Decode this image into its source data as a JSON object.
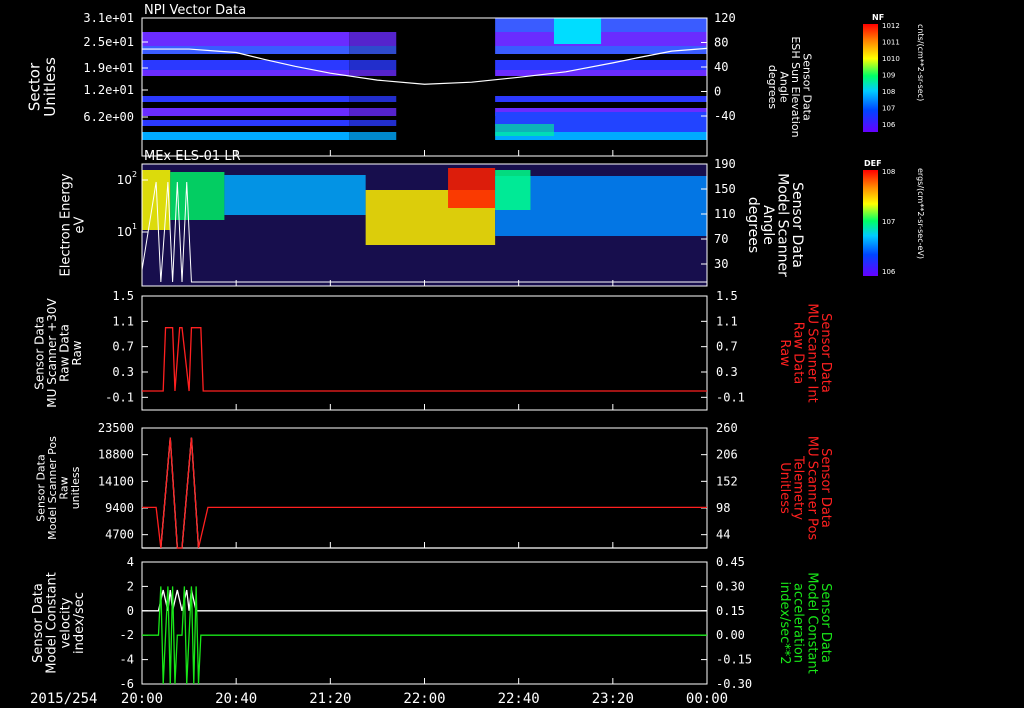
{
  "footer": {
    "date": "2015/254",
    "time_ticks": [
      "20:00",
      "20:40",
      "21:20",
      "22:00",
      "22:40",
      "23:20",
      "00:00"
    ]
  },
  "colors": {
    "background": "#000000",
    "white": "#ffffff",
    "red": "#ff2020",
    "green": "#19e619"
  },
  "chart_data": [
    {
      "type": "heatmap",
      "title": "NPI Vector Data",
      "ylabel": "Sector\nUnitless",
      "y_ticks": [
        "3.1e+01",
        "2.5e+01",
        "1.9e+01",
        "1.2e+01",
        "6.2e+00"
      ],
      "right_axis": {
        "label": "Sensor Data\nESH Sun Elevation\nAngle\ndegrees",
        "ticks": [
          "120",
          "80",
          "40",
          "0",
          "-40"
        ],
        "range": [
          -80,
          120
        ]
      },
      "colorbar": {
        "label": "NF",
        "units": "cnts/(cm**2-sr-sec)",
        "ticks": [
          "10^12",
          "10^11",
          "10^10",
          "10^9",
          "10^8",
          "10^7",
          "10^6"
        ]
      },
      "overlay_line": {
        "x": [
          0,
          20,
          32,
          40,
          52,
          65,
          80,
          100,
          120,
          140,
          160,
          180,
          200,
          210,
          225,
          240
        ],
        "y": [
          75,
          75,
          72,
          70,
          60,
          50,
          40,
          30,
          24,
          27,
          34,
          42,
          55,
          62,
          72,
          76
        ]
      }
    },
    {
      "type": "heatmap",
      "title": "MEx ELS-01 LR",
      "ylabel": "Electron Energy\neV",
      "y_ticks": [
        "10^2",
        "10^1"
      ],
      "right_axis": {
        "label": "Sensor Data\nModel Scanner\nAngle\ndegrees",
        "ticks": [
          "190",
          "150",
          "110",
          "70",
          "30"
        ]
      },
      "colorbar": {
        "label": "DEF",
        "units": "ergs/(cm**2-sr-sec-eV)",
        "ticks": [
          "10^8",
          "10^7",
          "10^6"
        ]
      }
    },
    {
      "type": "line",
      "ylabel": "Sensor Data\nMU Scanner +30V\nRaw Data\nRaw",
      "y_ticks": [
        "1.5",
        "1.1",
        "0.7",
        "0.3",
        "-0.1"
      ],
      "ylim": [
        -0.3,
        1.5
      ],
      "right_axis": {
        "label": "Sensor Data\nMU Scanner Int\nRaw Data\nRaw",
        "ticks": [
          "1.5",
          "1.1",
          "0.7",
          "0.3",
          "-0.1"
        ],
        "color": "#ff2020"
      },
      "series": [
        {
          "color": "#ff2020",
          "x": [
            0,
            5,
            9,
            10,
            13,
            14,
            16,
            17,
            20,
            21,
            25,
            26,
            240
          ],
          "y": [
            0,
            0,
            0,
            1,
            1,
            0,
            1,
            1,
            0,
            1,
            1,
            0,
            0
          ]
        }
      ]
    },
    {
      "type": "line",
      "ylabel": "Sensor Data\nModel Scanner Pos\nRaw\nunitless",
      "y_ticks": [
        "23500",
        "18800",
        "14100",
        "9400",
        "4700"
      ],
      "ylim": [
        0,
        23500
      ],
      "right_axis": {
        "label": "Sensor Data\nMU Scanner Pos\nTelemetry\nUnitless",
        "ticks": [
          "260",
          "206",
          "152",
          "98",
          "44"
        ],
        "range": [
          0,
          260
        ],
        "color": "#ff2020"
      },
      "series": [
        {
          "color": "#ffffff",
          "x": [
            0,
            6,
            8,
            12,
            15,
            17,
            21,
            24,
            28,
            240
          ],
          "y": [
            0,
            0,
            0,
            21600,
            0,
            0,
            21600,
            0,
            0,
            0
          ]
        },
        {
          "color": "#ff2020",
          "axis": "right",
          "x": [
            0,
            6,
            8,
            12,
            15,
            17,
            21,
            24,
            28,
            240
          ],
          "y": [
            88,
            88,
            0,
            239,
            0,
            0,
            239,
            0,
            88,
            88
          ]
        }
      ]
    },
    {
      "type": "line",
      "ylabel": "Sensor Data\nModel Constant\nvelocity\nindex/sec",
      "y_ticks": [
        "4",
        "2",
        "0",
        "-2",
        "-4",
        "-6"
      ],
      "ylim": [
        -6,
        4
      ],
      "right_axis": {
        "label": "Sensor Data\nModel Constant\nacceleration\nindex/sec**2",
        "ticks": [
          "0.45",
          "0.30",
          "0.15",
          "0.00",
          "-0.15",
          "-0.30"
        ],
        "range": [
          -0.3,
          0.45
        ],
        "color": "#19e619"
      },
      "series": [
        {
          "color": "#ffffff",
          "x": [
            0,
            7,
            9,
            11,
            12,
            13,
            15,
            17,
            19,
            20,
            21,
            23,
            240
          ],
          "y": [
            0,
            0,
            1.7,
            0,
            1.7,
            0,
            1.7,
            0,
            1.7,
            0,
            1.7,
            0,
            0
          ]
        },
        {
          "color": "#19e619",
          "axis": "right",
          "x": [
            0,
            7,
            8,
            9,
            11,
            12,
            13,
            14,
            15,
            17,
            18,
            19,
            21,
            22,
            23,
            24,
            25,
            240
          ],
          "y": [
            0,
            0,
            0.3,
            -0.3,
            0.3,
            -0.3,
            0.3,
            -0.3,
            0,
            0,
            0.3,
            -0.3,
            0.3,
            -0.3,
            0.3,
            -0.3,
            0,
            0
          ]
        }
      ]
    }
  ]
}
